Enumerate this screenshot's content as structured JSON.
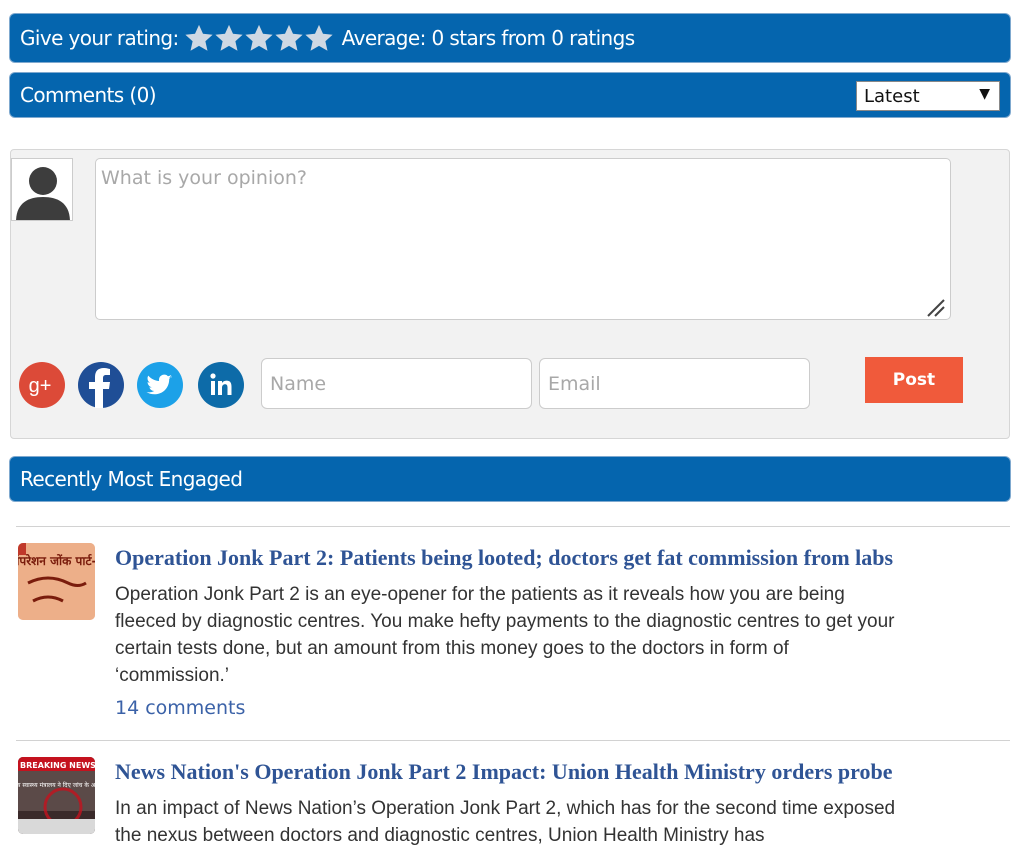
{
  "rating": {
    "label": "Give your rating:",
    "stars": [
      1,
      2,
      3,
      4,
      5
    ],
    "average_text": "Average: 0 stars from 0 ratings"
  },
  "comments": {
    "title": "Comments (0)",
    "sort_selected": "Latest"
  },
  "form": {
    "opinion_placeholder": "What is your opinion?",
    "name_placeholder": "Name",
    "email_placeholder": "Email",
    "post_label": "Post",
    "social_icons": [
      "google-plus-icon",
      "facebook-icon",
      "twitter-icon",
      "linkedin-icon"
    ]
  },
  "engaged": {
    "title": "Recently Most Engaged",
    "articles": [
      {
        "title": "Operation Jonk Part 2: Patients being looted; doctors get fat commission from labs",
        "description": "Operation Jonk Part 2 is an eye-opener for the patients as it reveals how you are being fleeced by diagnostic centres. You make hefty payments to the diagnostic centres to get your certain tests done, but an amount from this money goes to the doctors in form of ‘commission.’",
        "comments": "14 comments",
        "thumb_text": "ऑपरेशन जोंक पार्ट-2"
      },
      {
        "title": "News Nation's Operation Jonk Part 2 Impact: Union Health Ministry orders probe",
        "description": "In an impact of News Nation’s Operation Jonk Part 2, which has for the second time exposed the nexus between doctors and diagnostic centres, Union Health Ministry has",
        "thumb_text": "BREAKING NEWS",
        "thumb_subtext": "केंद्रीय स्वास्थ्य मंत्रालय ने दिए जांच के आदेश"
      }
    ]
  },
  "colors": {
    "bar_blue": "#0565ae",
    "post_red": "#f05a3b",
    "link_blue": "#2f5495"
  }
}
